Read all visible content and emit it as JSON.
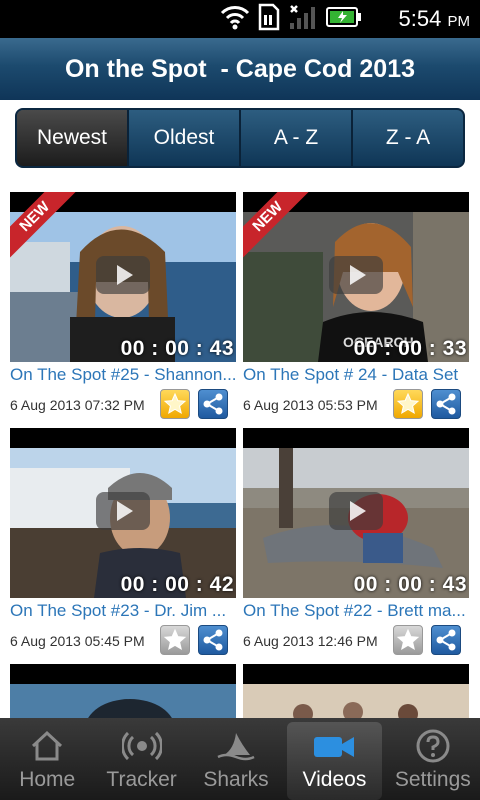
{
  "status": {
    "time": "5:54",
    "ampm": "PM",
    "icons": [
      "wifi-icon",
      "sd-card-icon",
      "signal-icon",
      "battery-icon"
    ]
  },
  "header": {
    "title": "On the Spot  - Cape Cod 2013"
  },
  "sort_tabs": [
    {
      "label": "Newest",
      "active": true
    },
    {
      "label": "Oldest",
      "active": false
    },
    {
      "label": "A - Z",
      "active": false
    },
    {
      "label": "Z - A",
      "active": false
    }
  ],
  "videos": [
    {
      "title": "On The Spot #25 - Shannon...",
      "date": "6 Aug 2013  07:32 PM",
      "duration": "00 : 00 : 43",
      "badge": "NEW",
      "favorite": true
    },
    {
      "title": "On The Spot # 24 - Data Set",
      "date": "6 Aug 2013  05:53 PM",
      "duration": "00 : 00 : 33",
      "badge": "NEW",
      "favorite": true
    },
    {
      "title": "On The Spot #23 - Dr. Jim ...",
      "date": "6 Aug 2013  05:45 PM",
      "duration": "00 : 00 : 42",
      "badge": "",
      "favorite": false
    },
    {
      "title": "On The Spot #22 - Brett ma...",
      "date": "6 Aug 2013  12:46 PM",
      "duration": "00 : 00 : 43",
      "badge": "",
      "favorite": false
    }
  ],
  "bottom_nav": [
    {
      "label": "Home",
      "icon": "home-icon",
      "active": false
    },
    {
      "label": "Tracker",
      "icon": "tracker-icon",
      "active": false
    },
    {
      "label": "Sharks",
      "icon": "shark-fin-icon",
      "active": false
    },
    {
      "label": "Videos",
      "icon": "video-camera-icon",
      "active": true
    },
    {
      "label": "Settings",
      "icon": "help-icon",
      "active": false
    }
  ],
  "colors": {
    "header": "#1c4a6e",
    "link": "#2c76b8",
    "star": "#f0a800",
    "ribbon": "#c8252b"
  }
}
